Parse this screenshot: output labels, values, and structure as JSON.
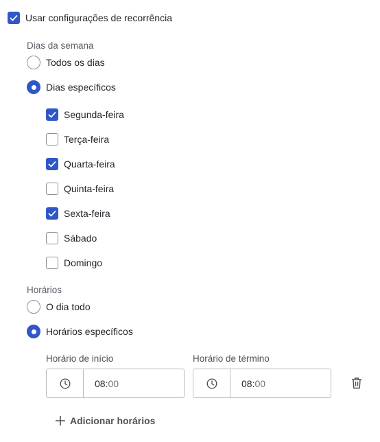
{
  "recurrence": {
    "label": "Usar configurações de recorrência",
    "checked": true
  },
  "weekdays": {
    "section_label": "Dias da semana",
    "modes": [
      {
        "label": "Todos os dias",
        "selected": false
      },
      {
        "label": "Dias específicos",
        "selected": true
      }
    ],
    "days": [
      {
        "label": "Segunda-feira",
        "checked": true
      },
      {
        "label": "Terça-feira",
        "checked": false
      },
      {
        "label": "Quarta-feira",
        "checked": true
      },
      {
        "label": "Quinta-feira",
        "checked": false
      },
      {
        "label": "Sexta-feira",
        "checked": true
      },
      {
        "label": "Sábado",
        "checked": false
      },
      {
        "label": "Domingo",
        "checked": false
      }
    ]
  },
  "times": {
    "section_label": "Horários",
    "modes": [
      {
        "label": "O dia todo",
        "selected": false
      },
      {
        "label": "Horários específicos",
        "selected": true
      }
    ],
    "start": {
      "label": "Horário de início",
      "hour": "08",
      "separator": ":",
      "minute": "00"
    },
    "end": {
      "label": "Horário de término",
      "hour": "08",
      "separator": ":",
      "minute": "00"
    },
    "add_label": "Adicionar horários"
  },
  "icons": {
    "clock": "clock-icon",
    "trash": "trash-icon",
    "plus": "plus-icon",
    "check": "check-icon"
  },
  "colors": {
    "accent": "#2f57c8",
    "border": "#b8bcc2",
    "muted_text": "#5b6068"
  }
}
